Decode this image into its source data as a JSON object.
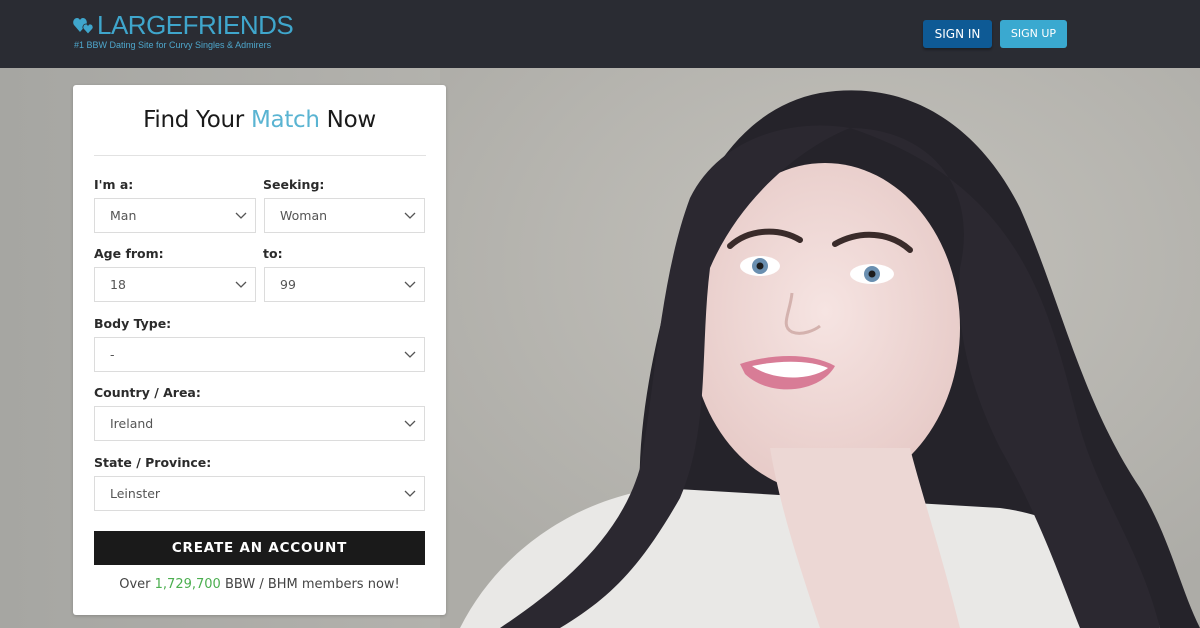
{
  "header": {
    "logo_text": "LARGEFRIENDS",
    "tagline": "#1 BBW Dating Site for Curvy Singles & Admirers",
    "logo_icon": "hearts-icon",
    "sign_in_label": "SIGN IN",
    "sign_up_label": "SIGN UP"
  },
  "colors": {
    "brand": "#3fa6cc",
    "sign_in_bg": "#0e5a95",
    "sign_up_bg": "#3aa9d0",
    "header_bg": "#2a2c33",
    "title_accent": "#5ab4d2",
    "member_count": "#4caf50",
    "create_button_bg": "#1a1a1a"
  },
  "form": {
    "title_part1": "Find Your ",
    "title_accent": "Match",
    "title_part2": " Now",
    "fields": {
      "gender": {
        "label": "I'm a:",
        "value": "Man"
      },
      "seeking": {
        "label": "Seeking:",
        "value": "Woman"
      },
      "age_from": {
        "label": "Age from:",
        "value": "18"
      },
      "age_to": {
        "label": "to:",
        "value": "99"
      },
      "body_type": {
        "label": "Body Type:",
        "value": "-"
      },
      "country": {
        "label": "Country / Area:",
        "value": "Ireland"
      },
      "state": {
        "label": "State / Province:",
        "value": "Leinster"
      }
    },
    "create_label": "CREATE AN ACCOUNT",
    "members_prefix": "Over ",
    "members_count": "1,729,700",
    "members_suffix": " BBW / BHM members now!"
  },
  "hero": {
    "image_description": "smiling woman with long dark wavy hair"
  }
}
